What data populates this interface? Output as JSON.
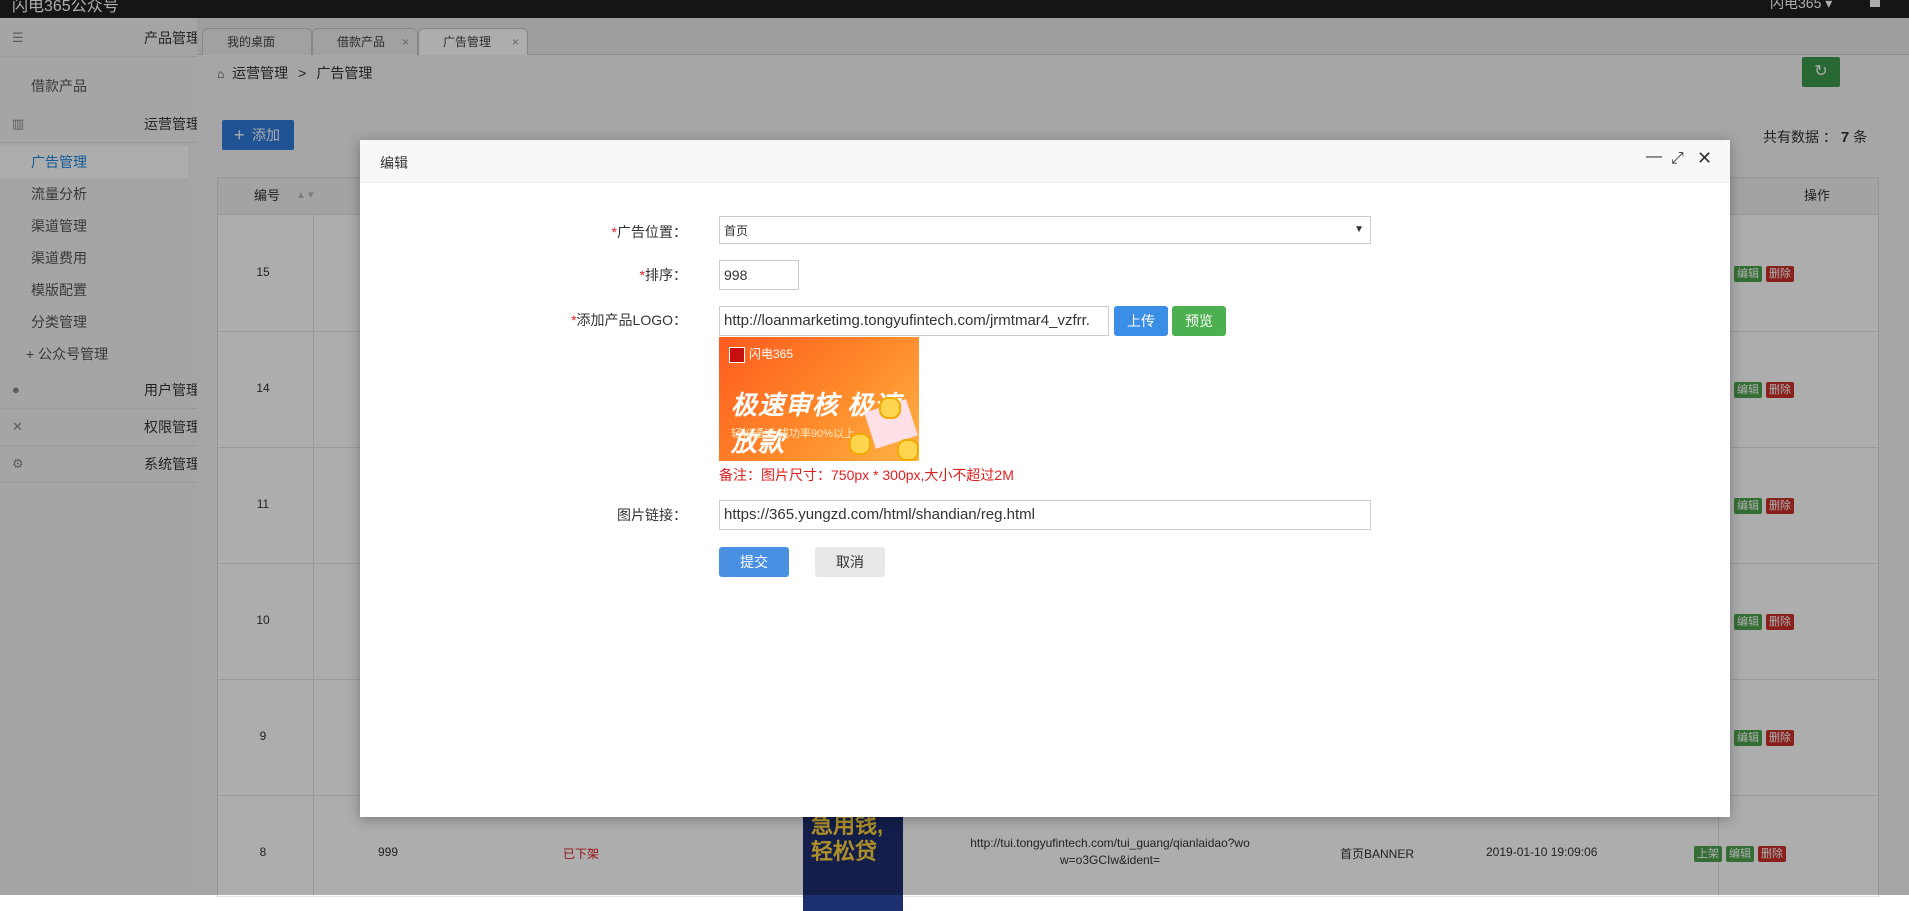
{
  "topbar": {
    "brand": "闪电365公众号",
    "user": "闪电365 ▾"
  },
  "sidebar": {
    "groups": [
      {
        "label": "产品管理",
        "icon": "list-icon",
        "expanded": true
      },
      {
        "label": "运营管理",
        "icon": "chart-icon",
        "expanded": true
      },
      {
        "label": "用户管理",
        "icon": "user-icon",
        "expanded": false
      },
      {
        "label": "权限管理",
        "icon": "tools-icon",
        "expanded": false
      },
      {
        "label": "系统管理",
        "icon": "gear-icon",
        "expanded": false
      }
    ],
    "product_items": [
      "借款产品"
    ],
    "ops_items": [
      "广告管理",
      "流量分析",
      "渠道管理",
      "渠道费用",
      "模版配置",
      "分类管理",
      "+ 公众号管理"
    ]
  },
  "tabs": [
    {
      "label": "我的桌面"
    },
    {
      "label": "借款产品",
      "close": "×"
    },
    {
      "label": "广告管理",
      "close": "×",
      "active": true
    }
  ],
  "breadcrumb": {
    "parent": "运营管理",
    "sep": ">",
    "current": "广告管理"
  },
  "toolbar": {
    "add_label": "添加",
    "total_prefix": "共有数据 ：",
    "total_count": "7",
    "total_suffix": "条"
  },
  "table": {
    "headers": {
      "id": "编号",
      "ops": "操作"
    },
    "rows": [
      {
        "id": "15",
        "ops": [
          "编辑",
          "删除"
        ]
      },
      {
        "id": "14",
        "ops": [
          "编辑",
          "删除"
        ]
      },
      {
        "id": "11",
        "ops": [
          "编辑",
          "删除"
        ]
      },
      {
        "id": "10",
        "ops": [
          "编辑",
          "删除"
        ]
      },
      {
        "id": "9",
        "ops": [
          "编辑",
          "删除"
        ]
      }
    ],
    "last_row": {
      "id": "8",
      "sort": "999",
      "status": "已下架",
      "image_text": "急用钱,轻松贷",
      "link_line1": "http://tui.tongyufintech.com/tui_guang/qianlaidao?wo",
      "link_line2": "w=o3GCIw&ident=",
      "position": "首页BANNER",
      "time": "2019-01-10 19:09:06",
      "ops": [
        "上架",
        "编辑",
        "删除"
      ]
    }
  },
  "modal": {
    "title": "编辑",
    "position_label": "广告位置：",
    "position_value": "首页",
    "sort_label": "排序：",
    "sort_value": "998",
    "logo_label": "添加产品LOGO：",
    "logo_url": "http://loanmarketimg.tongyufintech.com/jrmtmar4_vzfrr.",
    "upload_label": "上传",
    "preview_label": "预览",
    "banner": {
      "brand": "闪电365",
      "headline": "极速审核 极速放款",
      "sub": "轻松通过 成功率90%以上"
    },
    "note": "备注：图片尺寸：750px * 300px,大小不超过2M",
    "link_label": "图片链接：",
    "link_value": "https://365.yungzd.com/html/shandian/reg.html",
    "submit_label": "提交",
    "cancel_label": "取消",
    "required_mark": "*"
  }
}
